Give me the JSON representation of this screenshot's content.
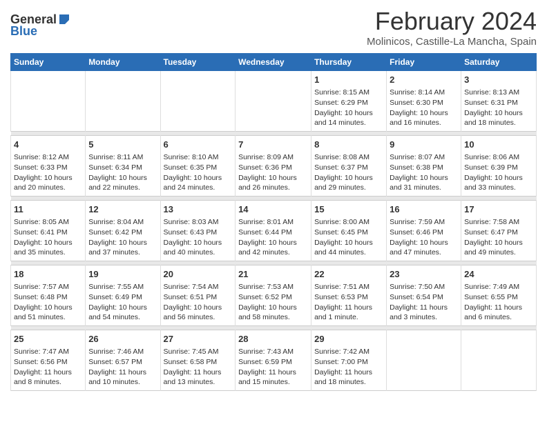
{
  "logo": {
    "general": "General",
    "blue": "Blue"
  },
  "title": "February 2024",
  "subtitle": "Molinicos, Castille-La Mancha, Spain",
  "weekdays": [
    "Sunday",
    "Monday",
    "Tuesday",
    "Wednesday",
    "Thursday",
    "Friday",
    "Saturday"
  ],
  "weeks": [
    [
      {
        "day": "",
        "info": ""
      },
      {
        "day": "",
        "info": ""
      },
      {
        "day": "",
        "info": ""
      },
      {
        "day": "",
        "info": ""
      },
      {
        "day": "1",
        "info": "Sunrise: 8:15 AM\nSunset: 6:29 PM\nDaylight: 10 hours\nand 14 minutes."
      },
      {
        "day": "2",
        "info": "Sunrise: 8:14 AM\nSunset: 6:30 PM\nDaylight: 10 hours\nand 16 minutes."
      },
      {
        "day": "3",
        "info": "Sunrise: 8:13 AM\nSunset: 6:31 PM\nDaylight: 10 hours\nand 18 minutes."
      }
    ],
    [
      {
        "day": "4",
        "info": "Sunrise: 8:12 AM\nSunset: 6:33 PM\nDaylight: 10 hours\nand 20 minutes."
      },
      {
        "day": "5",
        "info": "Sunrise: 8:11 AM\nSunset: 6:34 PM\nDaylight: 10 hours\nand 22 minutes."
      },
      {
        "day": "6",
        "info": "Sunrise: 8:10 AM\nSunset: 6:35 PM\nDaylight: 10 hours\nand 24 minutes."
      },
      {
        "day": "7",
        "info": "Sunrise: 8:09 AM\nSunset: 6:36 PM\nDaylight: 10 hours\nand 26 minutes."
      },
      {
        "day": "8",
        "info": "Sunrise: 8:08 AM\nSunset: 6:37 PM\nDaylight: 10 hours\nand 29 minutes."
      },
      {
        "day": "9",
        "info": "Sunrise: 8:07 AM\nSunset: 6:38 PM\nDaylight: 10 hours\nand 31 minutes."
      },
      {
        "day": "10",
        "info": "Sunrise: 8:06 AM\nSunset: 6:39 PM\nDaylight: 10 hours\nand 33 minutes."
      }
    ],
    [
      {
        "day": "11",
        "info": "Sunrise: 8:05 AM\nSunset: 6:41 PM\nDaylight: 10 hours\nand 35 minutes."
      },
      {
        "day": "12",
        "info": "Sunrise: 8:04 AM\nSunset: 6:42 PM\nDaylight: 10 hours\nand 37 minutes."
      },
      {
        "day": "13",
        "info": "Sunrise: 8:03 AM\nSunset: 6:43 PM\nDaylight: 10 hours\nand 40 minutes."
      },
      {
        "day": "14",
        "info": "Sunrise: 8:01 AM\nSunset: 6:44 PM\nDaylight: 10 hours\nand 42 minutes."
      },
      {
        "day": "15",
        "info": "Sunrise: 8:00 AM\nSunset: 6:45 PM\nDaylight: 10 hours\nand 44 minutes."
      },
      {
        "day": "16",
        "info": "Sunrise: 7:59 AM\nSunset: 6:46 PM\nDaylight: 10 hours\nand 47 minutes."
      },
      {
        "day": "17",
        "info": "Sunrise: 7:58 AM\nSunset: 6:47 PM\nDaylight: 10 hours\nand 49 minutes."
      }
    ],
    [
      {
        "day": "18",
        "info": "Sunrise: 7:57 AM\nSunset: 6:48 PM\nDaylight: 10 hours\nand 51 minutes."
      },
      {
        "day": "19",
        "info": "Sunrise: 7:55 AM\nSunset: 6:49 PM\nDaylight: 10 hours\nand 54 minutes."
      },
      {
        "day": "20",
        "info": "Sunrise: 7:54 AM\nSunset: 6:51 PM\nDaylight: 10 hours\nand 56 minutes."
      },
      {
        "day": "21",
        "info": "Sunrise: 7:53 AM\nSunset: 6:52 PM\nDaylight: 10 hours\nand 58 minutes."
      },
      {
        "day": "22",
        "info": "Sunrise: 7:51 AM\nSunset: 6:53 PM\nDaylight: 11 hours\nand 1 minute."
      },
      {
        "day": "23",
        "info": "Sunrise: 7:50 AM\nSunset: 6:54 PM\nDaylight: 11 hours\nand 3 minutes."
      },
      {
        "day": "24",
        "info": "Sunrise: 7:49 AM\nSunset: 6:55 PM\nDaylight: 11 hours\nand 6 minutes."
      }
    ],
    [
      {
        "day": "25",
        "info": "Sunrise: 7:47 AM\nSunset: 6:56 PM\nDaylight: 11 hours\nand 8 minutes."
      },
      {
        "day": "26",
        "info": "Sunrise: 7:46 AM\nSunset: 6:57 PM\nDaylight: 11 hours\nand 10 minutes."
      },
      {
        "day": "27",
        "info": "Sunrise: 7:45 AM\nSunset: 6:58 PM\nDaylight: 11 hours\nand 13 minutes."
      },
      {
        "day": "28",
        "info": "Sunrise: 7:43 AM\nSunset: 6:59 PM\nDaylight: 11 hours\nand 15 minutes."
      },
      {
        "day": "29",
        "info": "Sunrise: 7:42 AM\nSunset: 7:00 PM\nDaylight: 11 hours\nand 18 minutes."
      },
      {
        "day": "",
        "info": ""
      },
      {
        "day": "",
        "info": ""
      }
    ]
  ]
}
